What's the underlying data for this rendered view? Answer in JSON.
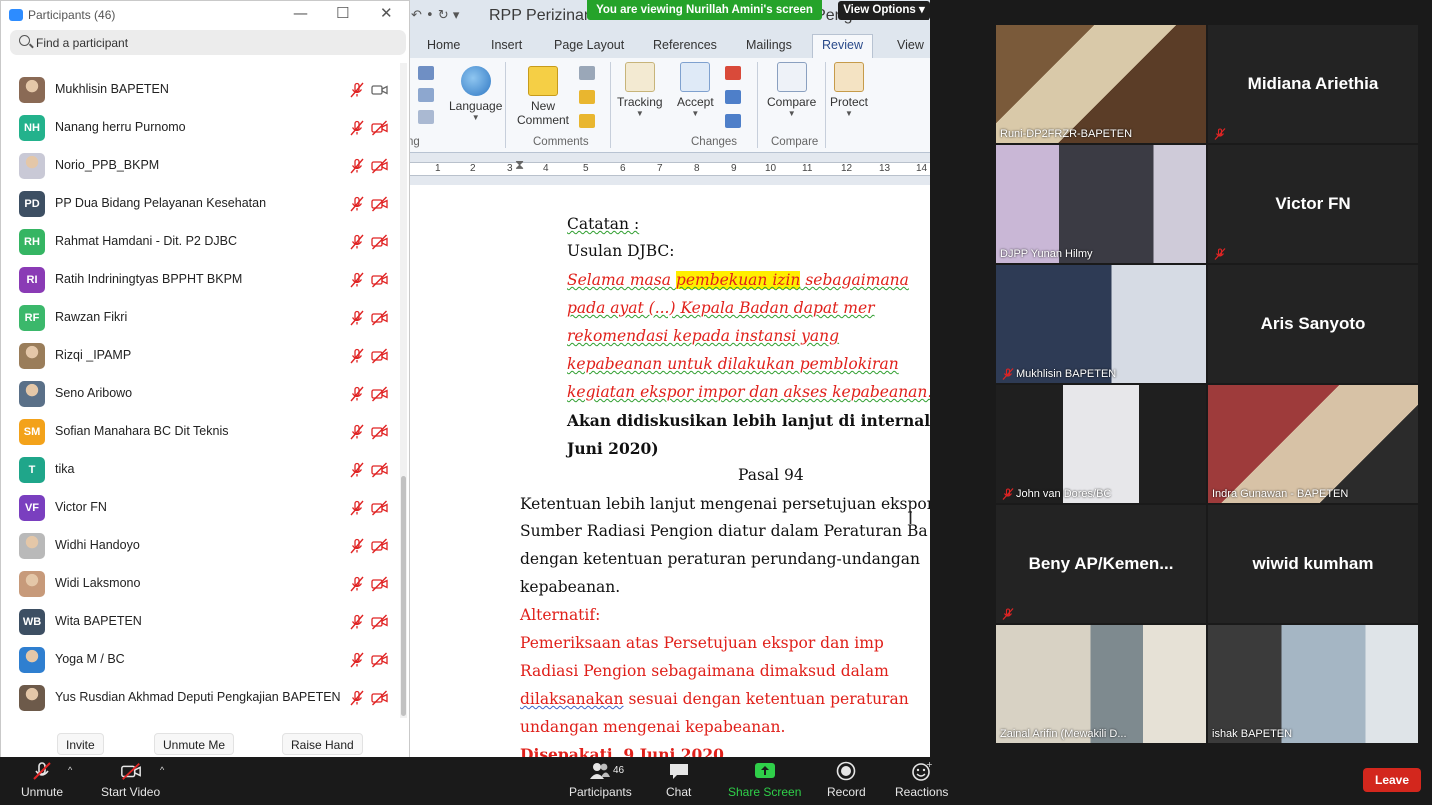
{
  "word": {
    "quick_access": "↶ • ↻  ▾",
    "doc_title": "RPP Perizinan Pemanfaatan Sumber Radiasi Pengion Hasil Re",
    "tabs": [
      "Home",
      "Insert",
      "Page Layout",
      "References",
      "Mailings",
      "Review",
      "View"
    ],
    "active_tab": "Review",
    "ribbon": {
      "language": "Language",
      "new_comment": "New Comment",
      "tracking": "Tracking",
      "accept": "Accept",
      "compare": "Compare",
      "protect": "Protect",
      "groups": [
        "Comments",
        "Changes",
        "Compare"
      ],
      "proofing_partial": "ng"
    },
    "ruler_numbers": [
      "1",
      "2",
      "3",
      "4",
      "5",
      "6",
      "7",
      "8",
      "9",
      "10",
      "11",
      "12",
      "13",
      "14"
    ],
    "doc_lines": {
      "l1": "Catatan :",
      "l2": "Usulan DJBC:",
      "l3a": "Selama  masa  ",
      "l3b": "pembekuan  izin",
      "l3c": "  sebagaimana",
      "l4": "pada  ayat  (...)  Kepala  Badan  dapat  mer",
      "l5": "rekomendasi    kepada    instansi    yang",
      "l6": "kepabeanan   untuk   dilakukan   pemblokiran",
      "l7": "kegiatan  ekspor impor dan akses kepabeanan.",
      "l8": "Akan  didiskusikan  lebih  lanjut  di  internal",
      "l9": "Juni 2020)",
      "l10": "Pasal 94",
      "l11": "Ketentuan lebih lanjut mengenai persetujuan ekspor",
      "l12": "Sumber Radiasi Pengion diatur dalam Peraturan Ba",
      "l13": "dengan ketentuan peraturan perundang-undangan",
      "l14": "kepabeanan.",
      "l15": "Alternatif:",
      "l16": "Pemeriksaan  atas  Persetujuan  ekspor  dan  imp",
      "l17": "Radiasi  Pengion  sebagaimana  dimaksud  dalam",
      "l18a": "dilaksanakan",
      "l18b": " sesuai dengan ketentuan peraturan",
      "l19": "undangan mengenai kepabeanan.",
      "l20": "Disepakati, 9 Juni 2020"
    }
  },
  "share_banner": "You are viewing Nurillah Amini's screen",
  "view_options": "View Options ▾",
  "participants": {
    "title": "Participants (46)",
    "search_placeholder": "Find a participant",
    "items": [
      {
        "name": "Mukhlisin BAPETEN",
        "initials": "",
        "color": "#8a6a55",
        "video_on": true
      },
      {
        "name": "Nanang herru Purnomo",
        "initials": "NH",
        "color": "#23b28c",
        "video_on": false
      },
      {
        "name": "Norio_PPB_BKPM",
        "initials": "",
        "color": "#c9c9d6",
        "video_on": false
      },
      {
        "name": "PP Dua Bidang Pelayanan Kesehatan",
        "initials": "PD",
        "color": "#3d4f63",
        "video_on": false
      },
      {
        "name": "Rahmat Hamdani - Dit. P2 DJBC",
        "initials": "RH",
        "color": "#35b563",
        "video_on": false
      },
      {
        "name": "Ratih Indriningtyas BPPHT BKPM",
        "initials": "RI",
        "color": "#8a3bb5",
        "video_on": false
      },
      {
        "name": "Rawzan Fikri",
        "initials": "RF",
        "color": "#3bb86b",
        "video_on": false
      },
      {
        "name": "Rizqi _IPAMP",
        "initials": "",
        "color": "#9a7d5a",
        "video_on": false
      },
      {
        "name": "Seno Aribowo",
        "initials": "",
        "color": "#5a7088",
        "video_on": false
      },
      {
        "name": "Sofian Manahara BC Dit Teknis",
        "initials": "SM",
        "color": "#f3a21a",
        "video_on": false
      },
      {
        "name": "tika",
        "initials": "T",
        "color": "#1fa68a",
        "video_on": false
      },
      {
        "name": "Victor FN",
        "initials": "VF",
        "color": "#7a3fbf",
        "video_on": false
      },
      {
        "name": "Widhi Handoyo",
        "initials": "",
        "color": "#b9b9b9",
        "video_on": false
      },
      {
        "name": "Widi Laksmono",
        "initials": "",
        "color": "#c79a7a",
        "video_on": false
      },
      {
        "name": "Wita BAPETEN",
        "initials": "WB",
        "color": "#3d4f63",
        "video_on": false
      },
      {
        "name": "Yoga M / BC",
        "initials": "",
        "color": "#2f7fd0",
        "video_on": false
      },
      {
        "name": "Yus Rusdian Akhmad Deputi Pengkajian BAPETEN",
        "initials": "",
        "color": "#6d5a4a",
        "video_on": false
      }
    ],
    "footer": {
      "invite": "Invite",
      "unmute_me": "Unmute Me",
      "raise_hand": "Raise Hand"
    }
  },
  "gallery": {
    "tiles": [
      {
        "label": "Runi-DP2FRZR-BAPETEN",
        "video": true,
        "muted": false
      },
      {
        "label": "Midiana Ariethia",
        "video": false,
        "muted": true
      },
      {
        "label": "DJPP Yunan Hilmy",
        "video": true,
        "muted": false
      },
      {
        "label": "Victor FN",
        "video": false,
        "muted": true
      },
      {
        "label": "Mukhlisin BAPETEN",
        "video": true,
        "muted": true
      },
      {
        "label": "Aris Sanyoto",
        "video": false,
        "muted": false
      },
      {
        "label": "John van Dores/BC",
        "video": true,
        "muted": true
      },
      {
        "label": "Indra Gunawan - BAPETEN",
        "video": true,
        "muted": false
      },
      {
        "label": "Beny  AP/Kemen...",
        "video": false,
        "muted": true
      },
      {
        "label": "wiwid kumham",
        "video": false,
        "muted": false
      },
      {
        "label": "Zainal Arifin (Mewakili D...",
        "video": true,
        "muted": false
      },
      {
        "label": "ishak BAPETEN",
        "video": true,
        "muted": false
      }
    ]
  },
  "toolbar": {
    "unmute": "Unmute",
    "start_video": "Start Video",
    "participants": "Participants",
    "participants_count": "46",
    "chat": "Chat",
    "share_screen": "Share Screen",
    "record": "Record",
    "reactions": "Reactions",
    "leave": "Leave"
  },
  "colors": {
    "zoom_blue": "#2d8cff",
    "share_green": "#25a32a",
    "leave_red": "#d3271d",
    "active_speaker": "#c6e04a",
    "doc_red": "#e0201a"
  }
}
